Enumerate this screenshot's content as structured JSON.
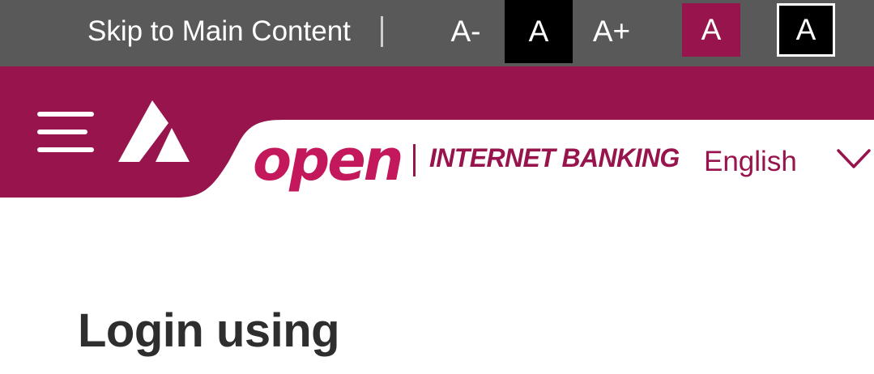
{
  "accessibility_bar": {
    "skip_link": "Skip to Main Content",
    "font_decrease": "A-",
    "font_normal": "A",
    "font_increase": "A+",
    "theme_default": "A",
    "theme_high_contrast": "A"
  },
  "header": {
    "brand_logo": "axis-bank-logo-icon",
    "open_logo": "open",
    "product_name": "INTERNET BANKING",
    "language": {
      "selected": "English"
    }
  },
  "main": {
    "title": "Login using"
  },
  "colors": {
    "toolbar_bg": "#595959",
    "brand": "#97144d",
    "brand_accent": "#c3185c",
    "title_text": "#2e2e2e"
  }
}
